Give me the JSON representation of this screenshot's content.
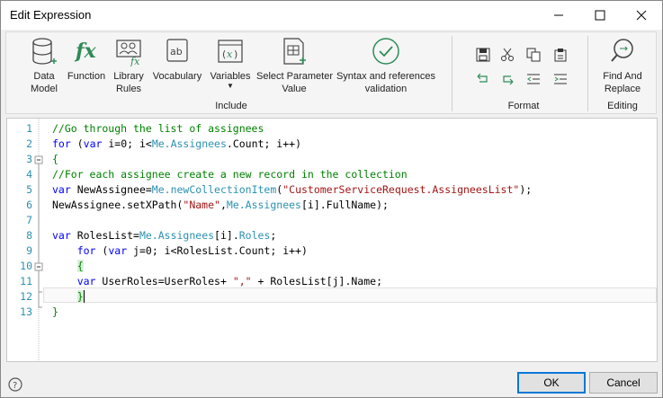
{
  "window": {
    "title": "Edit Expression"
  },
  "ribbon": {
    "include_buttons": [
      {
        "label": "Data\nModel",
        "icon": "database-icon"
      },
      {
        "label": "Function",
        "icon": "fx-icon"
      },
      {
        "label": "Library\nRules",
        "icon": "library-rules-icon"
      },
      {
        "label": "Vocabulary",
        "icon": "vocabulary-icon"
      },
      {
        "label": "Variables",
        "icon": "variables-icon"
      },
      {
        "label": "Select Parameter\nValue",
        "icon": "parameter-icon"
      },
      {
        "label": "Syntax and references\nvalidation",
        "icon": "checkmark-circle-icon"
      }
    ],
    "include_label": "Include",
    "format_label": "Format",
    "editing_label": "Editing",
    "find_replace_label": "Find And\nReplace"
  },
  "editor": {
    "line_numbers": [
      "1",
      "2",
      "3",
      "4",
      "5",
      "6",
      "7",
      "8",
      "9",
      "10",
      "11",
      "12",
      "13"
    ]
  },
  "footer": {
    "ok_label": "OK",
    "cancel_label": "Cancel",
    "help_icon": "help-icon"
  },
  "colors": {
    "keyword": "#0000ff",
    "comment": "#008000",
    "string": "#a31515",
    "object": "#2b91af"
  }
}
